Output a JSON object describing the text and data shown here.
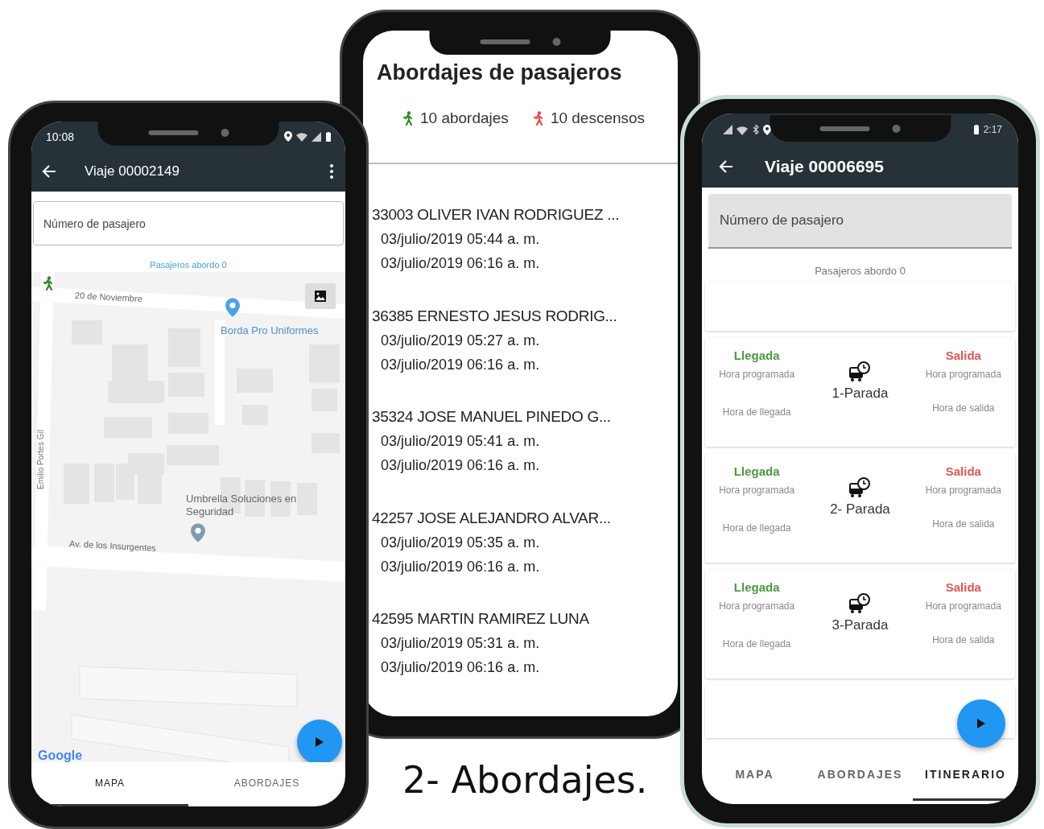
{
  "left_phone": {
    "status_bar": {
      "time": "10:08"
    },
    "app_bar": {
      "title": "Viaje 00002149"
    },
    "search": {
      "placeholder": "Número de pasajero"
    },
    "passengers_label": "Pasajeros abordo 0",
    "map": {
      "labels": [
        {
          "kind": "street",
          "text": "20 de Noviembre"
        },
        {
          "kind": "place",
          "text": "Borda Pro Uniformes"
        },
        {
          "kind": "vertical",
          "text": "Emilio Portes Gil"
        },
        {
          "kind": "poi",
          "text": "Umbrella Soluciones en Seguridad"
        },
        {
          "kind": "street",
          "text": "Av. de los Insurgentes"
        }
      ],
      "attribution": "Google"
    },
    "tabs": [
      {
        "label": "MAPA",
        "selected": true
      },
      {
        "label": "ABORDAJES",
        "selected": false
      }
    ]
  },
  "middle_phone": {
    "title": "Abordajes de pasajeros",
    "stats": [
      {
        "kind": "boarding",
        "text": "10 abordajes"
      },
      {
        "kind": "alighting",
        "text": "10 descensos"
      }
    ],
    "passengers": [
      {
        "name": "33003 OLIVER IVAN RODRIGUEZ ...",
        "boarded": "03/julio/2019 05:44 a. m.",
        "alighted": "03/julio/2019 06:16 a. m."
      },
      {
        "name": "36385 ERNESTO JESUS RODRIG...",
        "boarded": "03/julio/2019 05:27 a. m.",
        "alighted": "03/julio/2019 06:16 a. m."
      },
      {
        "name": "35324 JOSE MANUEL PINEDO G...",
        "boarded": "03/julio/2019 05:41 a. m.",
        "alighted": "03/julio/2019 06:16 a. m."
      },
      {
        "name": "42257 JOSE ALEJANDRO ALVAR...",
        "boarded": "03/julio/2019 05:35 a. m.",
        "alighted": "03/julio/2019 06:16 a. m."
      },
      {
        "name": "42595 MARTIN RAMIREZ LUNA",
        "boarded": "03/julio/2019 05:31 a. m.",
        "alighted": "03/julio/2019 06:16 a. m."
      }
    ]
  },
  "caption": "2- Abordajes.",
  "right_phone": {
    "status_bar": {
      "time": "2:17"
    },
    "app_bar": {
      "title": "Viaje 00006695"
    },
    "search": {
      "placeholder": "Número de pasajero"
    },
    "passengers_label": "Pasajeros abordo 0",
    "stops": [
      {
        "name": "1-Parada",
        "arrival": "Llegada",
        "arrival_scheduled": "Hora programada",
        "arrival_actual": "Hora de llegada",
        "departure": "Salida",
        "departure_scheduled": "Hora programada",
        "departure_actual": "Hora de salida"
      },
      {
        "name": "2- Parada",
        "arrival": "Llegada",
        "arrival_scheduled": "Hora programada",
        "arrival_actual": "Hora de llegada",
        "departure": "Salida",
        "departure_scheduled": "Hora programada",
        "departure_actual": "Hora de salida"
      },
      {
        "name": "3-Parada",
        "arrival": "Llegada",
        "arrival_scheduled": "Hora programada",
        "arrival_actual": "Hora de llegada",
        "departure": "Salida",
        "departure_scheduled": "Hora programada",
        "departure_actual": "Hora de salida"
      }
    ],
    "tabs": [
      {
        "label": "MAPA",
        "selected": false
      },
      {
        "label": "ABORDAJES",
        "selected": false
      },
      {
        "label": "ITINERARIO",
        "selected": true
      }
    ]
  }
}
